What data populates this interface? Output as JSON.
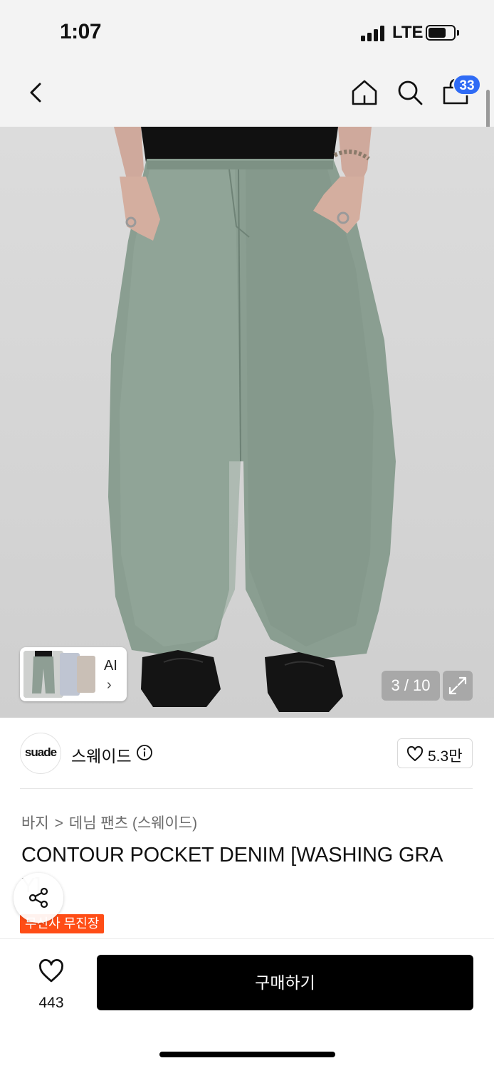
{
  "status_bar": {
    "time": "1:07",
    "network": "LTE",
    "battery_level_percent": 70
  },
  "header": {
    "back_icon": "chevron-left-icon",
    "home_icon": "home-icon",
    "search_icon": "search-icon",
    "cart_icon": "shopping-bag-icon",
    "cart_badge": "33",
    "badge_color": "#2f6bf5"
  },
  "gallery": {
    "ai_label": "AI",
    "ai_chevron": "›",
    "page_indicator": "3 / 10",
    "expand_icon": "expand-icon"
  },
  "brand": {
    "logo_text": "suade",
    "name": "스웨이드",
    "info_icon": "info-icon",
    "like_icon": "heart-outline-icon",
    "like_count": "5.3만"
  },
  "breadcrumb": {
    "items": [
      "바지",
      "데님 팬츠 (스웨이드)"
    ],
    "separator": ">"
  },
  "product": {
    "title_line1": "CONTOUR POCKET DENIM [WASHING GRA",
    "title_line2": "Y]",
    "promo_badge": "무신사 무진장",
    "promo_color": "#ff4d16",
    "share_icon": "share-icon"
  },
  "bottom_bar": {
    "like_icon": "heart-outline-icon",
    "like_count": "443",
    "buy_label": "구매하기"
  }
}
